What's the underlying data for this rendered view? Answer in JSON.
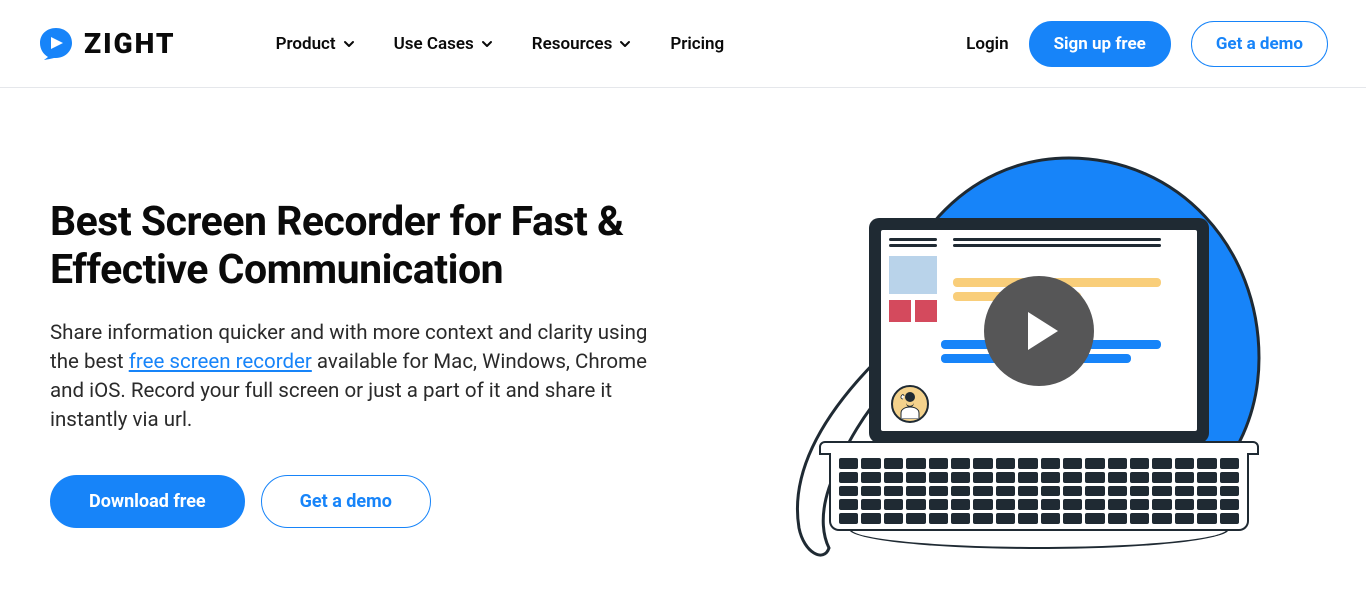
{
  "brand": "ZIGHT",
  "nav": {
    "items": [
      {
        "label": "Product",
        "has_dropdown": true
      },
      {
        "label": "Use Cases",
        "has_dropdown": true
      },
      {
        "label": "Resources",
        "has_dropdown": true
      },
      {
        "label": "Pricing",
        "has_dropdown": false
      }
    ]
  },
  "header_actions": {
    "login": "Login",
    "signup": "Sign up free",
    "demo": "Get a demo"
  },
  "hero": {
    "title": "Best Screen Recorder for Fast & Effective Communication",
    "sub_prefix": "Share information quicker and with more context and clarity using the best ",
    "sub_link": "free screen recorder",
    "sub_suffix": " available for Mac, Windows, Chrome and iOS. Record your full screen or just a part of it and share it instantly via url.",
    "cta_primary": "Download free",
    "cta_secondary": "Get a demo"
  },
  "colors": {
    "accent": "#1784f9",
    "ink": "#1f2a33",
    "yellow": "#f9ce7a",
    "red": "#d44a5d",
    "lightblue": "#b9d3ea"
  }
}
